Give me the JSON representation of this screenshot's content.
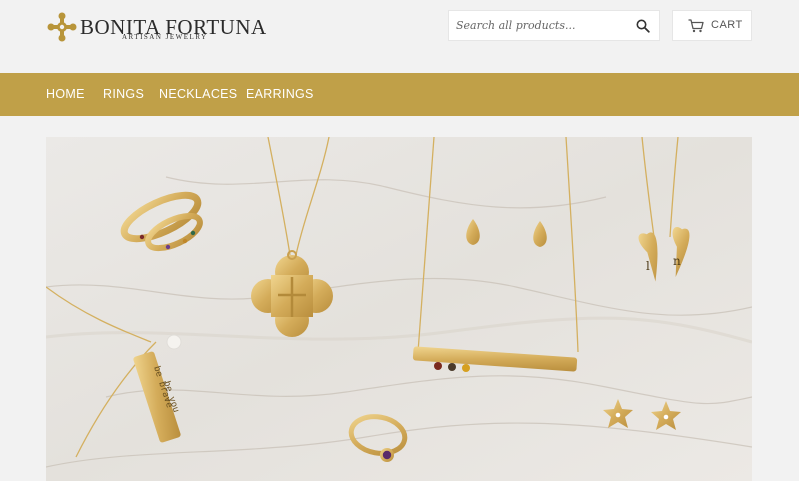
{
  "brand": {
    "name": "BONITA FORTUNA",
    "tagline": "ARTISAN JEWELRY"
  },
  "search": {
    "placeholder": "Search all products...",
    "icon": "magnifier-icon"
  },
  "cart": {
    "label": "CART",
    "icon": "shopping-cart-icon"
  },
  "nav": {
    "items": [
      {
        "label": "HOME"
      },
      {
        "label": "RINGS"
      },
      {
        "label": "NECKLACES"
      },
      {
        "label": "EARRINGS"
      }
    ]
  },
  "hero": {
    "engraving_line1": "be brave",
    "engraving_line2": "be you",
    "charm_letter_1": "l",
    "charm_letter_2": "n"
  },
  "colors": {
    "accent": "#c0a048",
    "background": "#f2f2f2",
    "gold": "#d9b86a",
    "marble": "#e9e6e2"
  }
}
